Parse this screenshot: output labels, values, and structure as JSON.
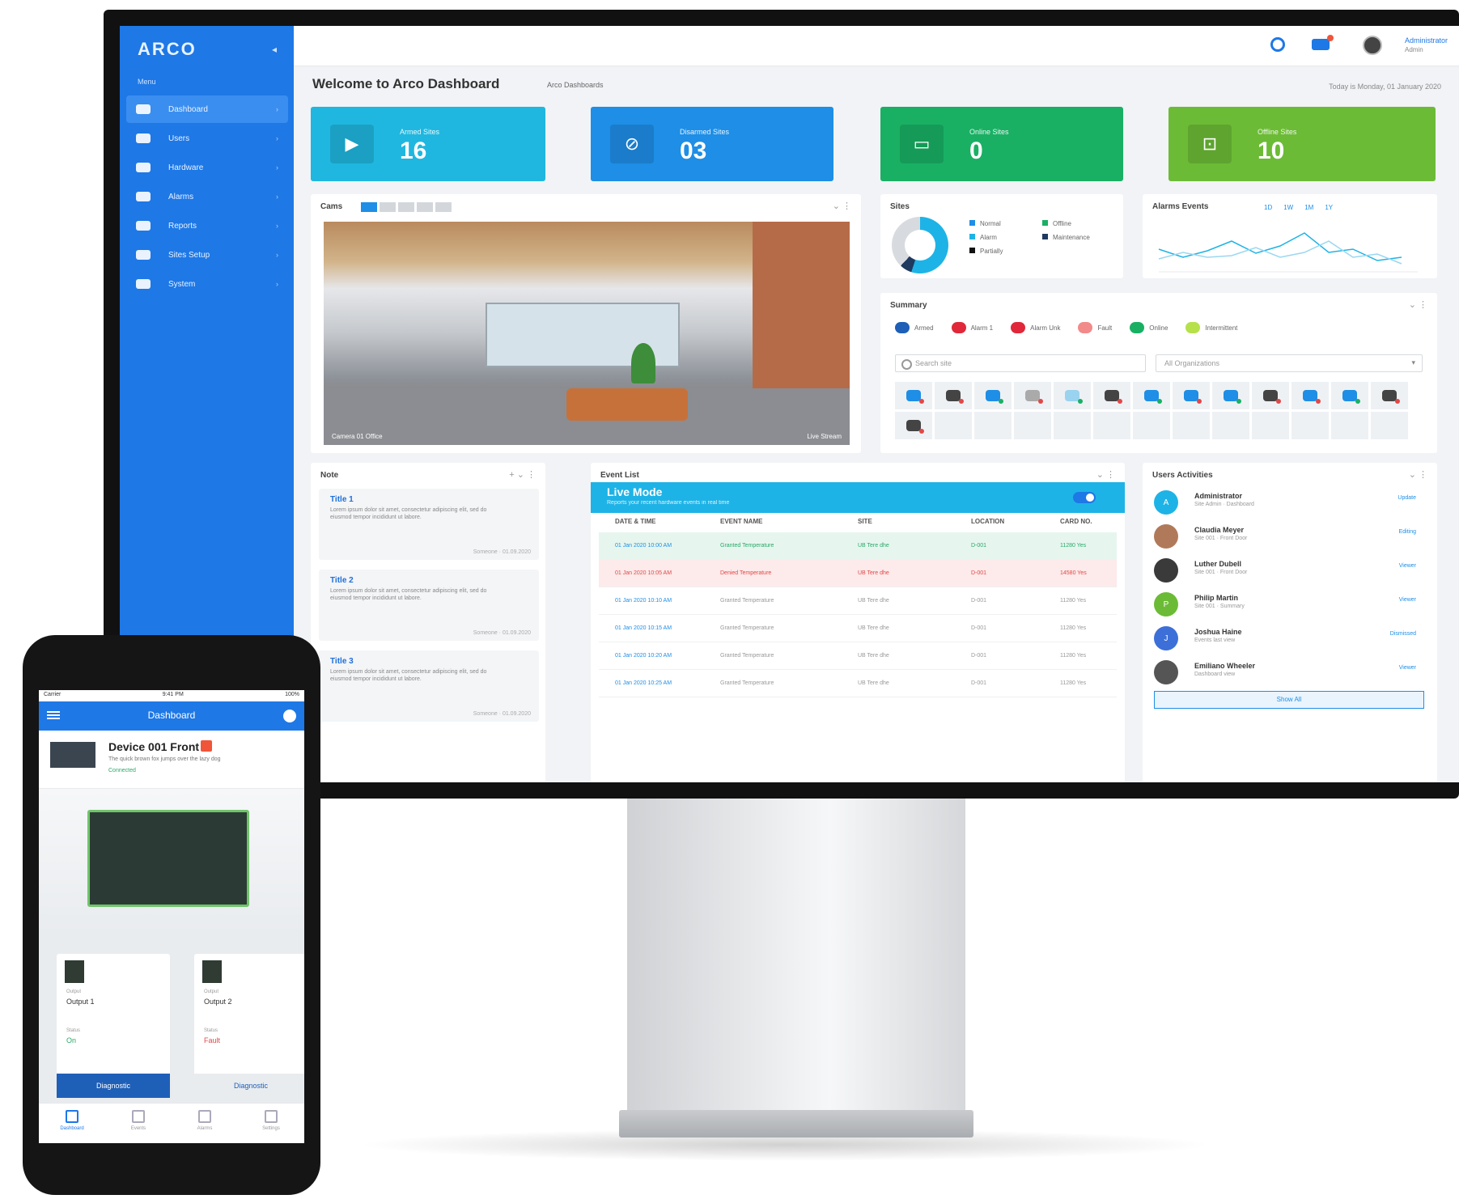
{
  "app": {
    "logo": "ARCO",
    "menu_label": "Menu",
    "welcome": "Welcome to Arco Dashboard",
    "welcome_tag": "Arco Dashboards",
    "date": "Today is Monday, 01 January 2020",
    "user_name": "Administrator",
    "user_role": "Admin"
  },
  "sidebar": {
    "items": [
      {
        "label": "Dashboard",
        "icon": "dashboard-icon",
        "active": true
      },
      {
        "label": "Users",
        "icon": "users-icon"
      },
      {
        "label": "Hardware",
        "icon": "hardware-icon"
      },
      {
        "label": "Alarms",
        "icon": "alarm-icon"
      },
      {
        "label": "Reports",
        "icon": "reports-icon"
      },
      {
        "label": "Sites Setup",
        "icon": "sites-icon"
      },
      {
        "label": "System",
        "icon": "system-icon"
      }
    ]
  },
  "stats": [
    {
      "label": "Armed Sites",
      "value": "16",
      "color": "#1fb7df"
    },
    {
      "label": "Disarmed Sites",
      "value": "03",
      "color": "#1e8ee6"
    },
    {
      "label": "Online Sites",
      "value": "0",
      "color": "#19b064"
    },
    {
      "label": "Offline Sites",
      "value": "10",
      "color": "#6cbb36"
    }
  ],
  "camera": {
    "title": "Cams",
    "cap_left": "Camera 01 Office",
    "cap_right": "Live Stream"
  },
  "sites": {
    "title": "Sites",
    "legend": [
      "Normal",
      "Offline",
      "Alarm",
      "Maintenance",
      "Partially"
    ]
  },
  "alarms": {
    "title": "Alarms Events",
    "tabs": [
      "1D",
      "1W",
      "1M",
      "1Y"
    ]
  },
  "summary": {
    "title": "Summary",
    "legend": [
      "Armed",
      "Alarm 1",
      "Alarm Unk",
      "Fault",
      "Online",
      "Intermittent"
    ],
    "search_placeholder": "Search site",
    "select_value": "All Organizations"
  },
  "notes": {
    "title": "Note",
    "items": [
      {
        "title": "Title 1",
        "body": "Lorem ipsum dolor sit amet, consectetur adipiscing elit, sed do eiusmod tempor incididunt ut labore.",
        "meta": "Someone · 01.09.2020"
      },
      {
        "title": "Title 2",
        "body": "Lorem ipsum dolor sit amet, consectetur adipiscing elit, sed do eiusmod tempor incididunt ut labore.",
        "meta": "Someone · 01.09.2020"
      },
      {
        "title": "Title 3",
        "body": "Lorem ipsum dolor sit amet, consectetur adipiscing elit, sed do eiusmod tempor incididunt ut labore.",
        "meta": "Someone · 01.09.2020"
      }
    ]
  },
  "events": {
    "title": "Event List",
    "live_title": "Live Mode",
    "live_sub": "Reports your recent hardware events in real time",
    "columns": [
      "DATE & TIME",
      "EVENT NAME",
      "SITE",
      "LOCATION",
      "CARD NO."
    ],
    "rows": [
      {
        "date": "01 Jan 2020 10:00 AM",
        "event": "Granted Temperature",
        "site": "UB Tere dhe",
        "loc": "D-001",
        "card": "11280 Yes",
        "state": "green"
      },
      {
        "date": "01 Jan 2020 10:05 AM",
        "event": "Denied Temperature",
        "site": "UB Tere dhe",
        "loc": "D-001",
        "card": "14580 Yes",
        "state": "red"
      },
      {
        "date": "01 Jan 2020 10:10 AM",
        "event": "Granted Temperature",
        "site": "UB Tere dhe",
        "loc": "D-001",
        "card": "11280 Yes",
        "state": ""
      },
      {
        "date": "01 Jan 2020 10:15 AM",
        "event": "Granted Temperature",
        "site": "UB Tere dhe",
        "loc": "D-001",
        "card": "11280 Yes",
        "state": ""
      },
      {
        "date": "01 Jan 2020 10:20 AM",
        "event": "Granted Temperature",
        "site": "UB Tere dhe",
        "loc": "D-001",
        "card": "11280 Yes",
        "state": ""
      },
      {
        "date": "01 Jan 2020 10:25 AM",
        "event": "Granted Temperature",
        "site": "UB Tere dhe",
        "loc": "D-001",
        "card": "11280 Yes",
        "state": ""
      }
    ]
  },
  "users": {
    "title": "Users Activities",
    "items": [
      {
        "name": "Administrator",
        "role": "Site Admin · Dashboard",
        "status": "Update",
        "initial": "A",
        "color": "#1eb3e6"
      },
      {
        "name": "Claudia Meyer",
        "role": "Site 001 · Front Door",
        "status": "Editing",
        "initial": "",
        "color": "#b07a5a"
      },
      {
        "name": "Luther Dubell",
        "role": "Site 001 · Front Door",
        "status": "Viewer",
        "initial": "",
        "color": "#3a3a3a"
      },
      {
        "name": "Philip Martin",
        "role": "Site 001 · Summary",
        "status": "Viewer",
        "initial": "P",
        "color": "#6cbb36"
      },
      {
        "name": "Joshua Haine",
        "role": "Events last view",
        "status": "Dismissed",
        "initial": "J",
        "color": "#3d6fd9"
      },
      {
        "name": "Emiliano Wheeler",
        "role": "Dashboard view",
        "status": "Viewer",
        "initial": "",
        "color": "#555"
      }
    ],
    "show_all": "Show All"
  },
  "phone": {
    "status_left": "Carrier",
    "status_time": "9:41 PM",
    "status_right": "100%",
    "nav_title": "Dashboard",
    "device_title": "Device 001 Front",
    "device_sub": "The quick brown fox jumps over the lazy dog",
    "device_state": "Connected",
    "cards": [
      {
        "tag": "Output",
        "out_label": "Output",
        "out": "Output 1",
        "state_label": "Status",
        "state": "On",
        "state_color": "#2aa868",
        "button": "Diagnostic"
      },
      {
        "tag": "Output",
        "out_label": "Output",
        "out": "Output 2",
        "state_label": "Status",
        "state": "Fault",
        "state_color": "#e04848",
        "button": "Diagnostic"
      }
    ],
    "tabs": [
      "Dashboard",
      "Events",
      "Alarms",
      "Settings"
    ]
  }
}
